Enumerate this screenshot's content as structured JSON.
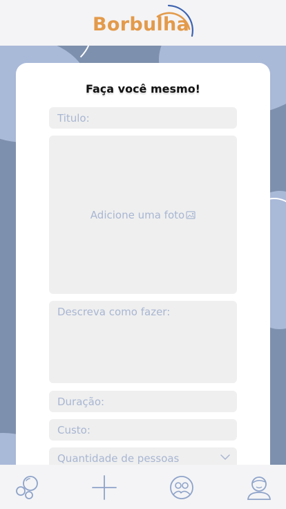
{
  "app": {
    "logo_text": "Borbulha"
  },
  "form": {
    "title": "Faça você mesmo!",
    "fields": {
      "titulo_placeholder": "Titulo:",
      "photo_label": "Adicione uma foto",
      "descricao_placeholder": "Descreva como fazer:",
      "duracao_placeholder": "Duração:",
      "custo_placeholder": "Custo:",
      "quantidade_placeholder": "Quantidade de pessoas"
    }
  },
  "nav": {
    "items": [
      {
        "icon": "bubbles-icon"
      },
      {
        "icon": "plus-icon"
      },
      {
        "icon": "group-icon"
      },
      {
        "icon": "profile-icon"
      }
    ]
  },
  "colors": {
    "brand": "#e39a4a",
    "accent_blue": "#3d63b0",
    "background": "#7d90ad",
    "bubble": "#a9b9d8",
    "field_bg": "#efefef",
    "placeholder": "#a8b6d2",
    "nav_icon": "#8ea3c9"
  }
}
